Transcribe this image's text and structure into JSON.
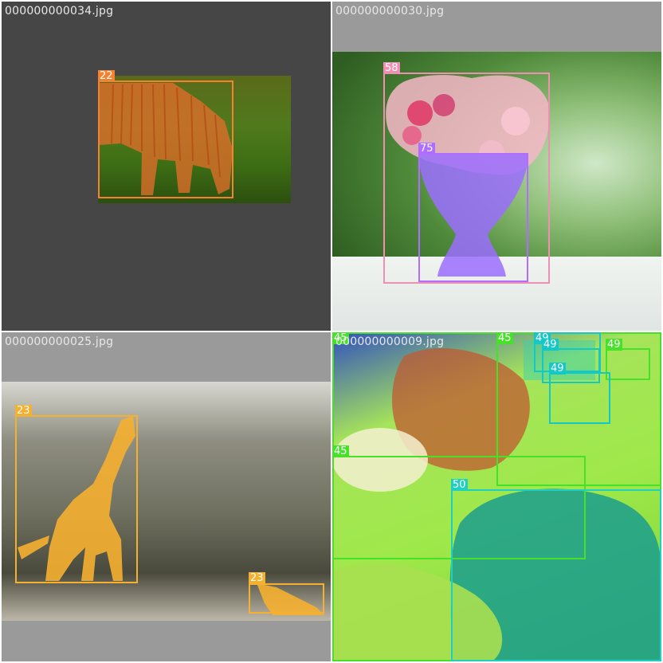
{
  "tiles": [
    {
      "filename": "000000000034.jpg"
    },
    {
      "filename": "000000000030.jpg"
    },
    {
      "filename": "000000000025.jpg"
    },
    {
      "filename": "000000000009.jpg"
    }
  ],
  "colors": {
    "zebra": "#f58231",
    "flower": "#f08fb4",
    "vase": "#9b6dff",
    "giraffe": "#f5b030",
    "bowl": "#47e02a",
    "orange": "#14c8c8",
    "broccoli": "#1fd0c0"
  },
  "labels": {
    "zebra": "22",
    "potted_plant": "58",
    "vase": "75",
    "giraffe_a": "23",
    "giraffe_b": "23",
    "bowl_a": "45",
    "bowl_b": "45",
    "bowl_c": "45",
    "orange_a": "49",
    "orange_b": "49",
    "orange_c": "49",
    "orange_d": "49",
    "broccoli": "50"
  }
}
